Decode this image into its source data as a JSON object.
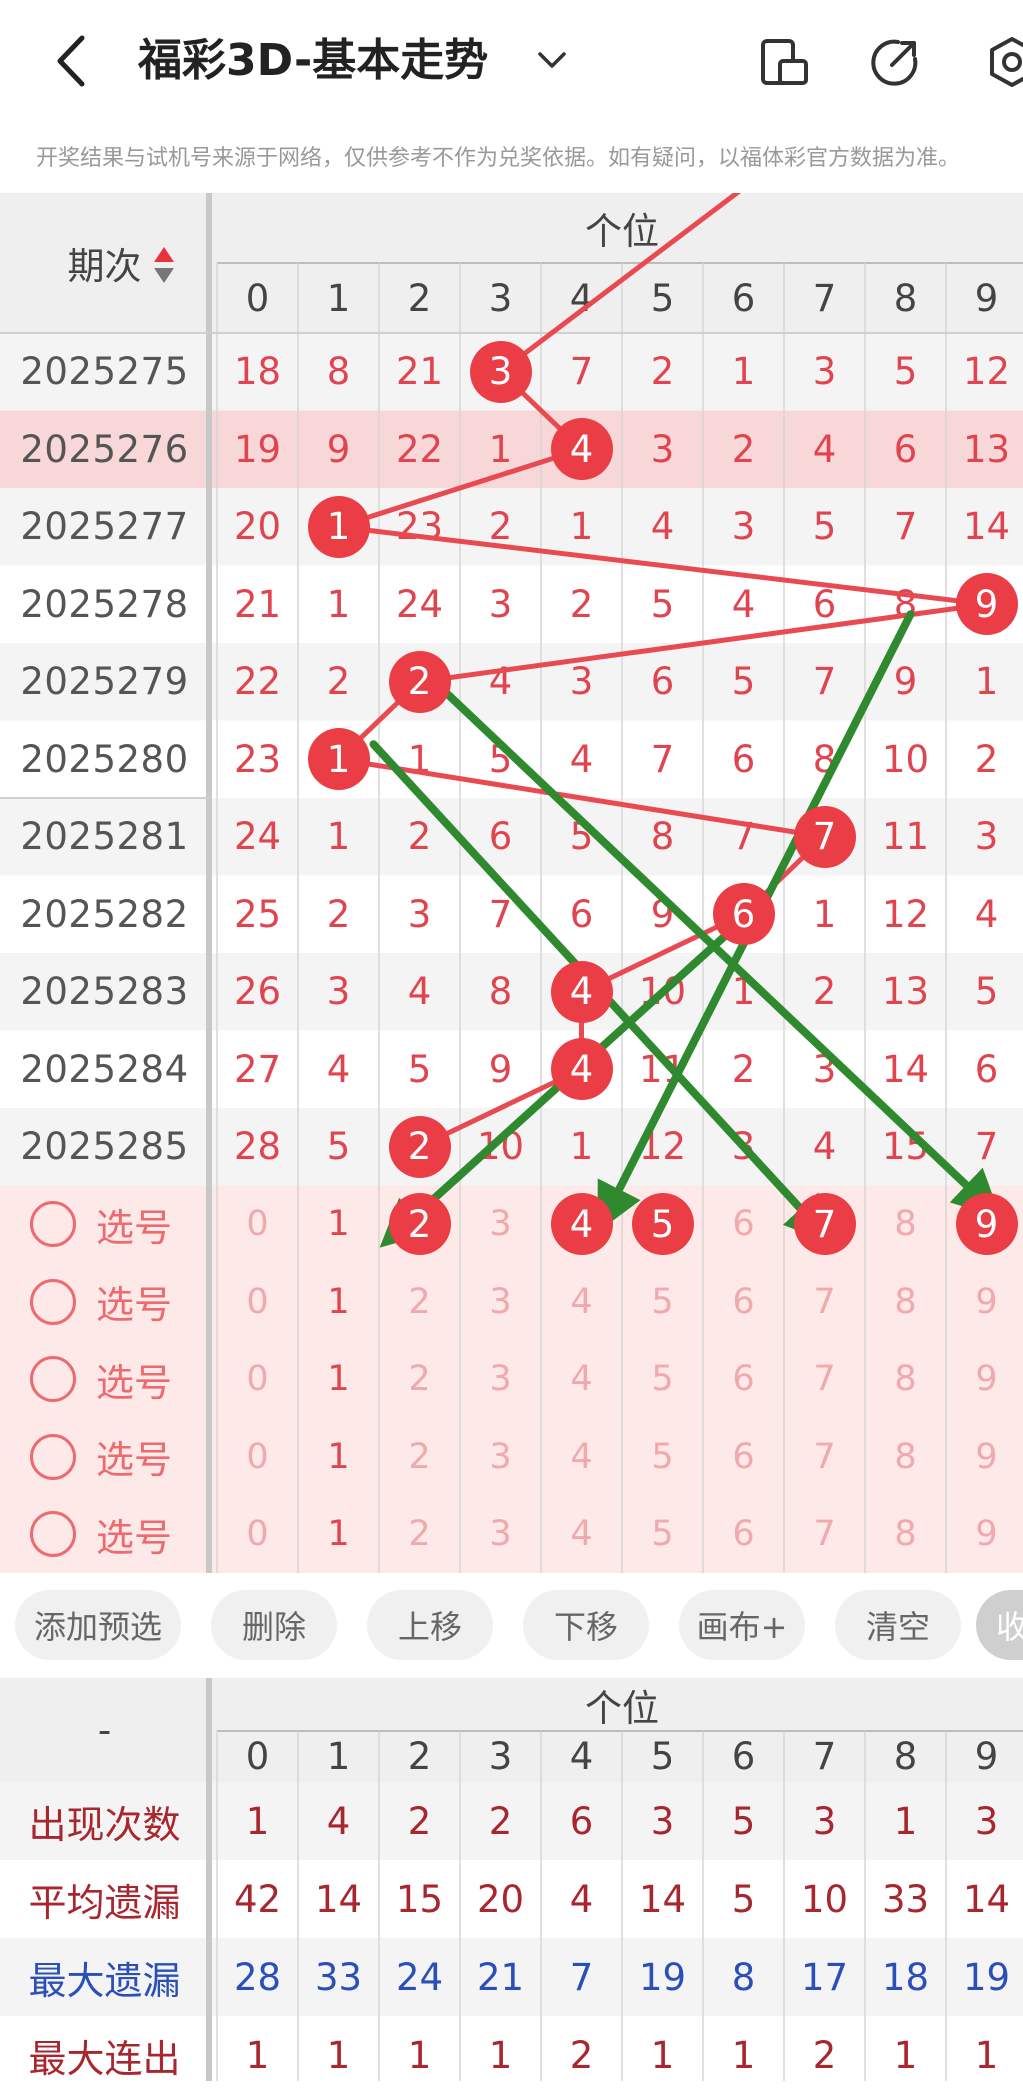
{
  "header": {
    "title": "福彩3D-基本走势",
    "notice": "开奖结果与试机号来源于网络，仅供参考不作为兑奖依据。如有疑问，以福体彩官方数据为准。"
  },
  "table": {
    "period_header": "期次",
    "group_header": "个位",
    "digits": [
      "0",
      "1",
      "2",
      "3",
      "4",
      "5",
      "6",
      "7",
      "8",
      "9"
    ],
    "rows": [
      {
        "period": "2025275",
        "cells": [
          "18",
          "8",
          "21",
          "3",
          "7",
          "2",
          "1",
          "3",
          "5",
          "12"
        ],
        "hit": 3
      },
      {
        "period": "2025276",
        "cells": [
          "19",
          "9",
          "22",
          "1",
          "4",
          "3",
          "2",
          "4",
          "6",
          "13"
        ],
        "hit": 4,
        "highlight": true
      },
      {
        "period": "2025277",
        "cells": [
          "20",
          "1",
          "23",
          "2",
          "1",
          "4",
          "3",
          "5",
          "7",
          "14"
        ],
        "hit": 1
      },
      {
        "period": "2025278",
        "cells": [
          "21",
          "1",
          "24",
          "3",
          "2",
          "5",
          "4",
          "6",
          "8",
          "9"
        ],
        "hit": 9
      },
      {
        "period": "2025279",
        "cells": [
          "22",
          "2",
          "2",
          "4",
          "3",
          "6",
          "5",
          "7",
          "9",
          "1"
        ],
        "hit": 2
      },
      {
        "period": "2025280",
        "cells": [
          "23",
          "1",
          "1",
          "5",
          "4",
          "7",
          "6",
          "8",
          "10",
          "2"
        ],
        "hit": 1
      },
      {
        "period": "2025281",
        "cells": [
          "24",
          "1",
          "2",
          "6",
          "5",
          "8",
          "7",
          "7",
          "11",
          "3"
        ],
        "hit": 7
      },
      {
        "period": "2025282",
        "cells": [
          "25",
          "2",
          "3",
          "7",
          "6",
          "9",
          "6",
          "1",
          "12",
          "4"
        ],
        "hit": 6
      },
      {
        "period": "2025283",
        "cells": [
          "26",
          "3",
          "4",
          "8",
          "4",
          "10",
          "1",
          "2",
          "13",
          "5"
        ],
        "hit": 4
      },
      {
        "period": "2025284",
        "cells": [
          "27",
          "4",
          "5",
          "9",
          "4",
          "11",
          "2",
          "3",
          "14",
          "6"
        ],
        "hit": 4
      },
      {
        "period": "2025285",
        "cells": [
          "28",
          "5",
          "2",
          "10",
          "1",
          "12",
          "3",
          "4",
          "15",
          "7"
        ],
        "hit": 2
      }
    ],
    "select_label": "选号",
    "select_rows": [
      {
        "selected": [
          2,
          4,
          5,
          7,
          9
        ]
      },
      {
        "selected": []
      },
      {
        "selected": []
      },
      {
        "selected": []
      },
      {
        "selected": []
      }
    ]
  },
  "toolbar": {
    "buttons": [
      "添加预选",
      "删除",
      "上移",
      "下移",
      "画布+",
      "清空"
    ],
    "collapse": "收"
  },
  "stats": {
    "corner": "-",
    "group_header": "个位",
    "digits": [
      "0",
      "1",
      "2",
      "3",
      "4",
      "5",
      "6",
      "7",
      "8",
      "9"
    ],
    "rows": [
      {
        "label": "出现次数",
        "values": [
          "1",
          "4",
          "2",
          "2",
          "6",
          "3",
          "5",
          "3",
          "1",
          "3"
        ],
        "color": "red"
      },
      {
        "label": "平均遗漏",
        "values": [
          "42",
          "14",
          "15",
          "20",
          "4",
          "14",
          "5",
          "10",
          "33",
          "14"
        ],
        "color": "red"
      },
      {
        "label": "最大遗漏",
        "values": [
          "28",
          "33",
          "24",
          "21",
          "7",
          "19",
          "8",
          "17",
          "18",
          "19"
        ],
        "color": "blue"
      },
      {
        "label": "最大连出",
        "values": [
          "1",
          "1",
          "1",
          "1",
          "2",
          "1",
          "1",
          "2",
          "1",
          "1"
        ],
        "color": "red"
      }
    ]
  },
  "colors": {
    "ball": "#ea3d45",
    "number": "#e0454f",
    "trend_line": "#e94a52",
    "drawn_arrow": "#2f8a2f",
    "highlight_row": "#f8d7d9",
    "select_bg": "#fde9e7"
  }
}
